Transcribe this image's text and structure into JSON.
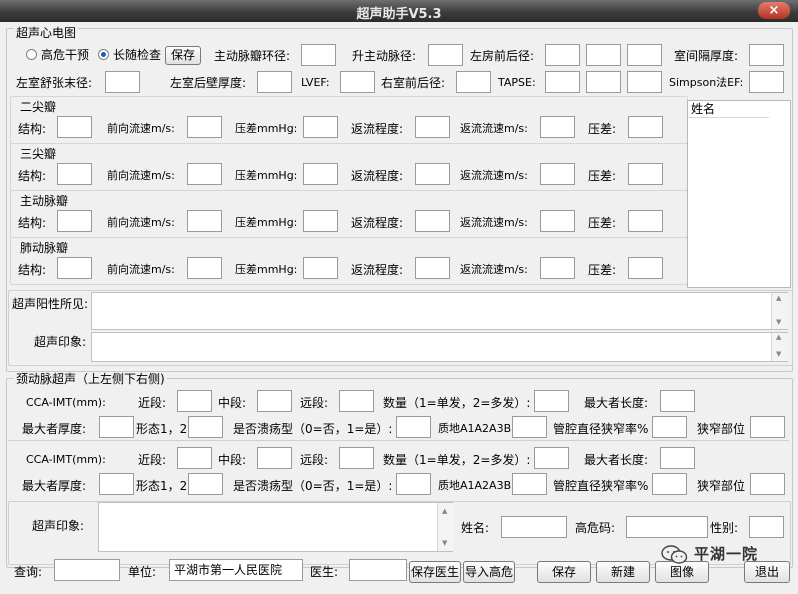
{
  "window": {
    "title": "超声助手V5.3",
    "close": "×"
  },
  "echo": {
    "group_title": "超声心电图",
    "radio_high_risk": "高危干预",
    "radio_follow": "长随检查",
    "save_btn": "保存",
    "lbl_aortic_annulus": "主动脉瓣环径:",
    "lbl_asc_aorta": "升主动脉径:",
    "lbl_la_ap": "左房前后径:",
    "lbl_ivs": "室间隔厚度:",
    "lbl_lvedd": "左室舒张末径:",
    "lbl_lvpw": "左室后壁厚度:",
    "lbl_lvef": "LVEF:",
    "lbl_rv_ap": "右室前后径:",
    "lbl_tapse": "TAPSE:",
    "lbl_simpson": "Simpson法EF:",
    "valves": [
      {
        "name": "二尖瓣"
      },
      {
        "name": "三尖瓣"
      },
      {
        "name": "主动脉瓣"
      },
      {
        "name": "肺动脉瓣"
      }
    ],
    "valve_fields": {
      "structure": "结构:",
      "forward_velocity": "前向流速m/s:",
      "pressure_gradient": "压差mmHg:",
      "regurg_degree": "返流程度:",
      "regurg_velocity": "返流流速m/s:",
      "pressure_diff": "压差:"
    },
    "name_list_header": "姓名",
    "positive_findings_label": "超声阳性所见:",
    "impression_label": "超声印象:"
  },
  "carotid": {
    "group_title": "颈动脉超声（上左侧下右侧)",
    "rows": [
      {
        "cca_imt": "CCA-IMT(mm):",
        "near": "近段:",
        "mid": "中段:",
        "far": "远段:",
        "count": "数量（1=单发，2=多发）:",
        "max_length": "最大者长度:",
        "max_thickness": "最大者厚度:",
        "morphology": "形态1，2",
        "ulcer": "是否溃疡型（0=否，1=是）:",
        "texture": "质地A1A2A3B",
        "stenosis_rate": "管腔直径狭窄率%",
        "stenosis_site": "狭窄部位"
      },
      {
        "cca_imt": "CCA-IMT(mm):",
        "near": "近段:",
        "mid": "中段:",
        "far": "远段:",
        "count": "数量（1=单发，2=多发）:",
        "max_length": "最大者长度:",
        "max_thickness": "最大者厚度:",
        "morphology": "形态1，2",
        "ulcer": "是否溃疡型（0=否，1=是）:",
        "texture": "质地A1A2A3B",
        "stenosis_rate": "管腔直径狭窄率%",
        "stenosis_site": "狭窄部位"
      }
    ],
    "impression_label": "超声印象:",
    "name_label": "姓名:",
    "risk_code_label": "高危码:",
    "gender_label": "性别:"
  },
  "footer": {
    "query_label": "查询:",
    "unit_label": "单位:",
    "unit_value": "平湖市第一人民医院",
    "doctor_label": "医生:",
    "save_doctor_btn": "保存医生",
    "import_risk_btn": "导入高危",
    "save_btn": "保存",
    "new_btn": "新建",
    "image_btn": "图像",
    "exit_btn": "退出"
  },
  "watermark": "平湖一院"
}
